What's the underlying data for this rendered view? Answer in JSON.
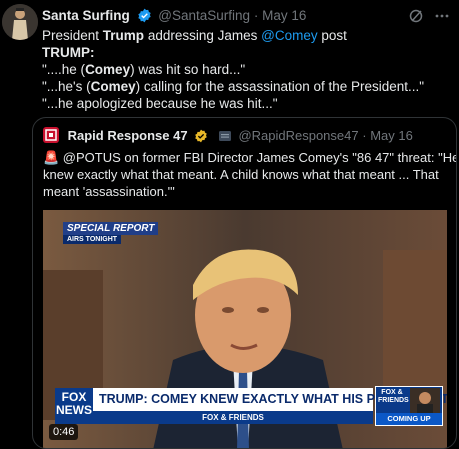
{
  "tweet": {
    "author_name": "Santa Surfing",
    "handle": "@SantaSurfing",
    "separator": "·",
    "date": "May 16",
    "lines": [
      {
        "parts": [
          {
            "t": "President ",
            "c": ""
          },
          {
            "t": "Trump",
            "c": "b"
          },
          {
            "t": " addressing James ",
            "c": ""
          },
          {
            "t": "@Comey",
            "c": "mention"
          },
          {
            "t": " post",
            "c": ""
          }
        ]
      },
      {
        "parts": [
          {
            "t": "TRUMP:",
            "c": "b"
          }
        ]
      },
      {
        "parts": [
          {
            "t": "\"....he (",
            "c": ""
          },
          {
            "t": "Comey",
            "c": "b"
          },
          {
            "t": ") was hit so hard...\"",
            "c": ""
          }
        ]
      },
      {
        "parts": [
          {
            "t": "\"...he's (",
            "c": ""
          },
          {
            "t": "Comey",
            "c": "b"
          },
          {
            "t": ") calling for the assassination of the President...\"",
            "c": ""
          }
        ]
      },
      {
        "parts": [
          {
            "t": "\"...he apologized because he was hit...\"",
            "c": ""
          }
        ]
      }
    ]
  },
  "quote": {
    "author_name": "Rapid Response 47",
    "handle": "@RapidResponse47",
    "separator": "·",
    "date": "May 16",
    "text_lines": [
      "🚨 @POTUS on former FBI Director James Comey's \"86 47\" threat: \"He",
      "knew exactly what that meant. A child knows what that meant ... That",
      "meant 'assassination.'\""
    ],
    "video": {
      "time": "0:46",
      "special_report": "SPECIAL REPORT",
      "airs_tonight": "AIRS TONIGHT",
      "chyron": "TRUMP: COMEY KNEW EXACTLY WHAT HIS POST MEANT",
      "network_strip": "FOX & FRIENDS",
      "logo_top": "FOX",
      "logo_bottom": "NEWS",
      "promo_title": "FOX & FRIENDS",
      "promo_footer": "COMING UP"
    }
  },
  "colors": {
    "accent": "#1d9bf0",
    "muted": "#71767b",
    "border": "#2f3336"
  }
}
